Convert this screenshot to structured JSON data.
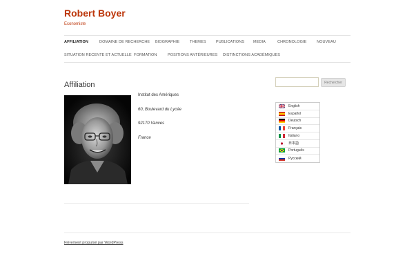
{
  "site": {
    "title": "Robert Boyer",
    "tagline": "Economiste"
  },
  "nav": {
    "row1": [
      "AFFILIATION",
      "DOMAINE DE RECHERCHE",
      "BIOGRAPHIE",
      "THEMES",
      "PUBLICATIONS",
      "MEDIA",
      "CHRONOLOGIE",
      "NOUVEAU"
    ],
    "row2": [
      "SITUATION RECENTE ET ACTUELLE",
      "FORMATION",
      "POSITIONS ANTÉRIEURES",
      "DISTINCTIONS ACADÉMIQUES"
    ],
    "active": "AFFILIATION"
  },
  "main": {
    "title": "Affiliation",
    "address": {
      "institution": "Institut des Amériques",
      "street": "60, Boulevard du Lycée",
      "city": "92170 Vanves",
      "country": "France"
    }
  },
  "sidebar": {
    "search_placeholder": "",
    "search_button": "Rechercher",
    "languages": [
      {
        "label": "English",
        "flag": "uk-flag-icon"
      },
      {
        "label": "Español",
        "flag": "spain-flag-icon"
      },
      {
        "label": "Deutsch",
        "flag": "germany-flag-icon"
      },
      {
        "label": "Français",
        "flag": "france-flag-icon"
      },
      {
        "label": "Italiano",
        "flag": "italy-flag-icon"
      },
      {
        "label": "日本語",
        "flag": "japan-flag-icon"
      },
      {
        "label": "Português",
        "flag": "brazil-flag-icon"
      },
      {
        "label": "Русский",
        "flag": "russia-flag-icon"
      }
    ]
  },
  "footer": {
    "credit": "Fièrement propulsé par WordPress"
  },
  "colors": {
    "accent": "#bc360a"
  }
}
